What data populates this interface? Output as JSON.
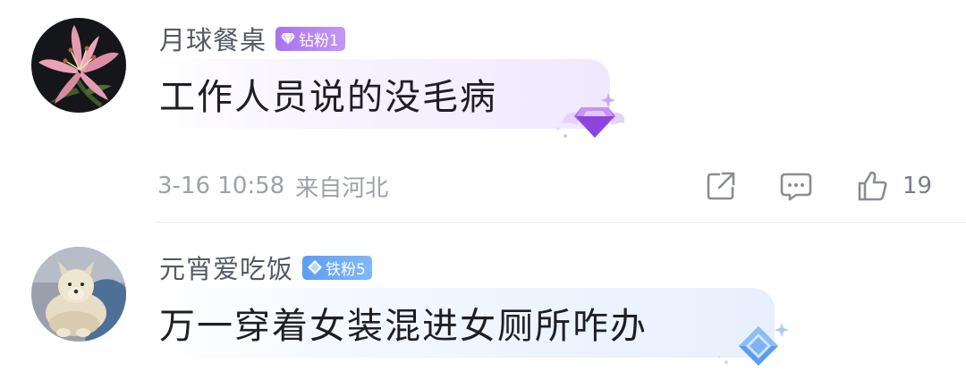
{
  "comments": [
    {
      "username": "月球餐桌",
      "badge": {
        "label": "钻粉1",
        "tier": "diamond",
        "color": "#b27ef4"
      },
      "text": "工作人员说的没毛病",
      "time": "3-16 10:58",
      "location": "来自河北",
      "like_count": "19",
      "avatar": "lily-flower-avatar"
    },
    {
      "username": "元宵爱吃饭",
      "badge": {
        "label": "铁粉5",
        "tier": "iron",
        "color": "#6aa8f6"
      },
      "text": "万一穿着女装混进女厕所咋办",
      "avatar": "fluffy-dog-avatar"
    }
  ],
  "icons": {
    "share": "share-icon",
    "reply": "comment-icon",
    "like": "thumbs-up-icon"
  }
}
